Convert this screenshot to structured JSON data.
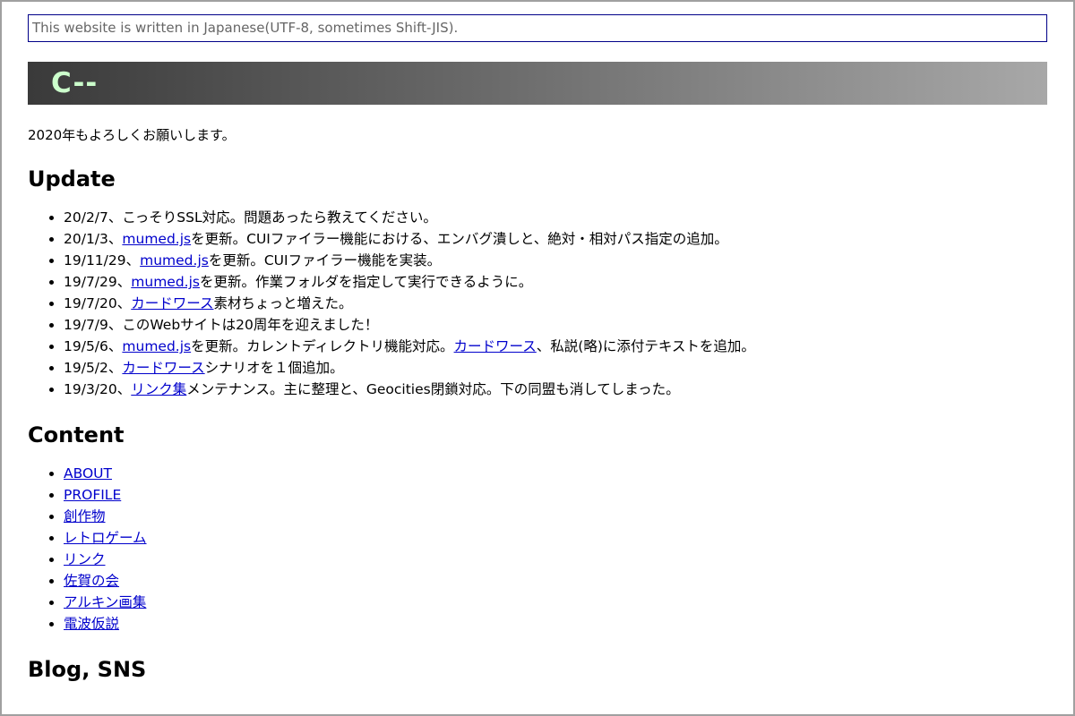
{
  "notice": "This website is written in Japanese(UTF-8, sometimes Shift-JIS).",
  "site_title": "C--",
  "greeting": "2020年もよろしくお願いします。",
  "update": {
    "heading": "Update",
    "items": [
      [
        {
          "t": "20/2/7、こっそりSSL対応。問題あったら教えてください。"
        }
      ],
      [
        {
          "t": "20/1/3、"
        },
        {
          "t": "mumed.js",
          "link": true
        },
        {
          "t": "を更新。CUIファイラー機能における、エンバグ潰しと、絶対・相対パス指定の追加。"
        }
      ],
      [
        {
          "t": "19/11/29、"
        },
        {
          "t": "mumed.js",
          "link": true
        },
        {
          "t": "を更新。CUIファイラー機能を実装。"
        }
      ],
      [
        {
          "t": "19/7/29、"
        },
        {
          "t": "mumed.js",
          "link": true
        },
        {
          "t": "を更新。作業フォルダを指定して実行できるように。"
        }
      ],
      [
        {
          "t": "19/7/20、"
        },
        {
          "t": "カードワース",
          "link": true
        },
        {
          "t": "素材ちょっと増えた。"
        }
      ],
      [
        {
          "t": "19/7/9、このWebサイトは20周年を迎えました！"
        }
      ],
      [
        {
          "t": "19/5/6、"
        },
        {
          "t": "mumed.js",
          "link": true
        },
        {
          "t": "を更新。カレントディレクトリ機能対応。"
        },
        {
          "t": "カードワース",
          "link": true
        },
        {
          "t": "、私説(略)に添付テキストを追加。"
        }
      ],
      [
        {
          "t": "19/5/2、"
        },
        {
          "t": "カードワース",
          "link": true
        },
        {
          "t": "シナリオを１個追加。"
        }
      ],
      [
        {
          "t": "19/3/20、"
        },
        {
          "t": "リンク集",
          "link": true
        },
        {
          "t": "メンテナンス。主に整理と、Geocities閉鎖対応。下の同盟も消してしまった。"
        }
      ]
    ]
  },
  "content": {
    "heading": "Content",
    "links": [
      "ABOUT",
      "PROFILE",
      "創作物",
      "レトロゲーム",
      "リンク",
      "佐賀の会",
      "アルキン画集",
      "電波仮説"
    ]
  },
  "blog": {
    "heading": "Blog, SNS"
  }
}
